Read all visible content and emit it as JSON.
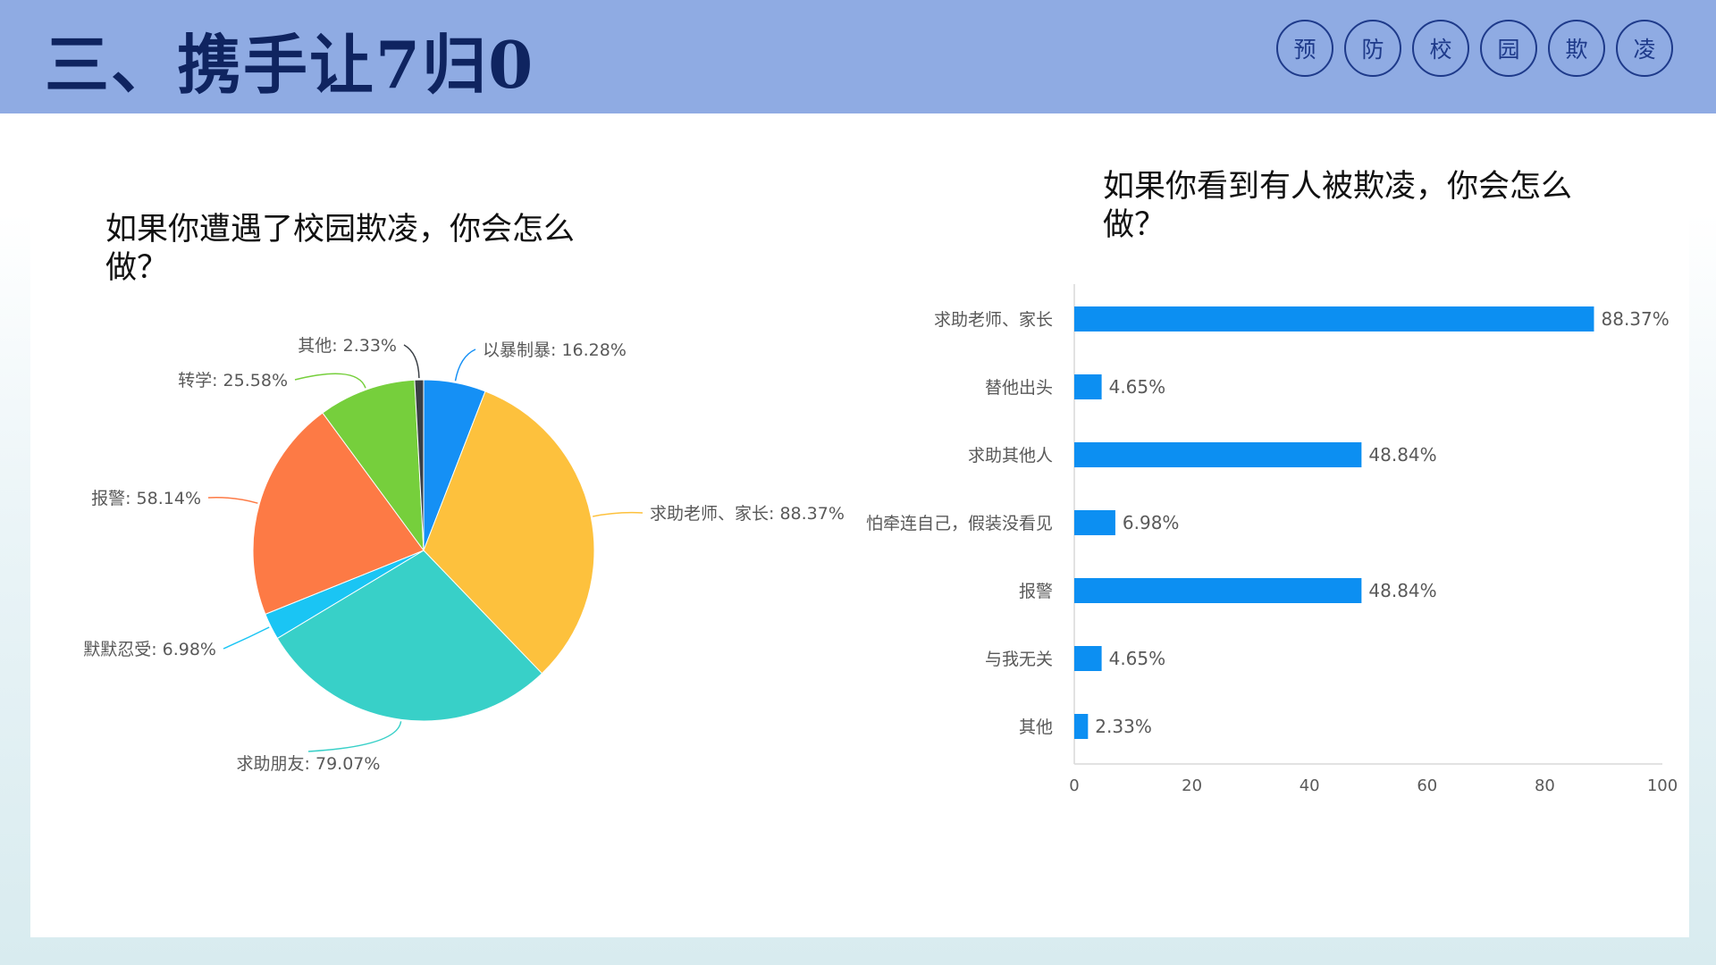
{
  "header": {
    "title": "三、携手让7归0",
    "badges": [
      "预",
      "防",
      "校",
      "园",
      "欺",
      "凌"
    ]
  },
  "colors": {
    "header_band": "#8fabe3",
    "title_text": "#0f2460",
    "bar_fill": "#0c8ff2"
  },
  "chart_data": [
    {
      "type": "pie",
      "title": "如果你遭遇了校园欺凌，你会怎么做？",
      "categories": [
        "以暴制暴",
        "求助老师、家长",
        "求助朋友",
        "默默忍受",
        "报警",
        "转学",
        "其他"
      ],
      "values": [
        16.28,
        88.37,
        79.07,
        6.98,
        58.14,
        25.58,
        2.33
      ],
      "labels": [
        "以暴制暴: 16.28%",
        "求助老师、家长: 88.37%",
        "求助朋友: 79.07%",
        "默默忍受: 6.98%",
        "报警: 58.14%",
        "转学: 25.58%",
        "其他: 2.33%"
      ],
      "colors": [
        "#1590f5",
        "#fdc13d",
        "#38d0c8",
        "#1ac5f4",
        "#fd7a45",
        "#76cf3c",
        "#3a3f45"
      ],
      "legend": "none"
    },
    {
      "type": "bar",
      "orientation": "horizontal",
      "title": "如果你看到有人被欺凌，你会怎么做？",
      "categories": [
        "求助老师、家长",
        "替他出头",
        "求助其他人",
        "怕牵连自己，假装没看见",
        "报警",
        "与我无关",
        "其他"
      ],
      "values": [
        88.37,
        4.65,
        48.84,
        6.98,
        48.84,
        4.65,
        2.33
      ],
      "value_labels": [
        "88.37%",
        "4.65%",
        "48.84%",
        "6.98%",
        "48.84%",
        "4.65%",
        "2.33%"
      ],
      "xlim": [
        0,
        100
      ],
      "xticks": [
        "0",
        "20",
        "40",
        "60",
        "80",
        "100"
      ],
      "grid": false,
      "legend": "none"
    }
  ]
}
